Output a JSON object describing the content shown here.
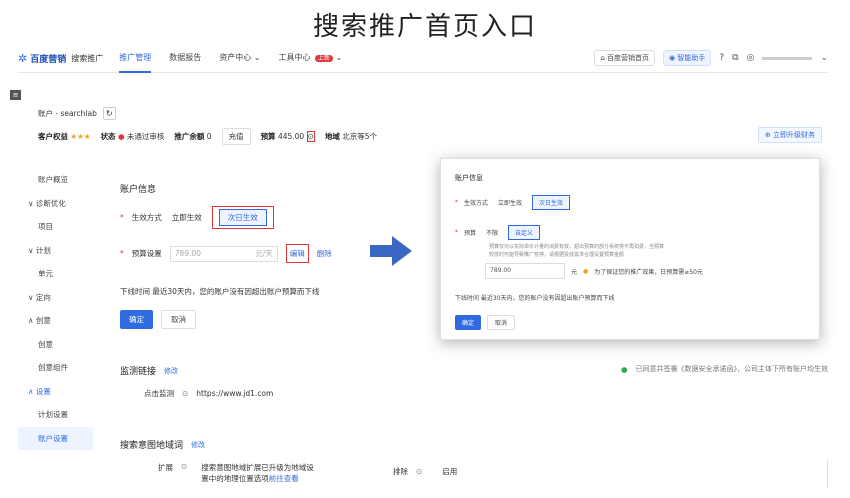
{
  "slide_title": "搜索推广首页入口",
  "topbar": {
    "logo": "百度营销",
    "logo_sub": "搜索推广",
    "nav": [
      {
        "label": "推广管理",
        "active": true
      },
      {
        "label": "数据报告",
        "active": false
      },
      {
        "label": "资产中心 ⌄",
        "active": false
      },
      {
        "label": "工具中心",
        "active": false
      }
    ],
    "tool_badge": "上新",
    "home_link": "百度营销首页",
    "assistant": "智能助手"
  },
  "account": {
    "name": "账户 - searchlab",
    "rights_label": "客户权益",
    "stars": "★★★",
    "status_label": "状态",
    "status_value": "未通过审核",
    "balance_label": "推广余额",
    "balance_value": "0",
    "recharge": "充值",
    "budget_label": "预算",
    "budget_value": "445.00",
    "region_label": "地域",
    "region_value": "北京等5个",
    "upgrade": "立即升级财务"
  },
  "sidebar": [
    {
      "label": "账户概览",
      "type": "item"
    },
    {
      "label": "诊断优化",
      "type": "group"
    },
    {
      "label": "项目",
      "type": "item"
    },
    {
      "label": "计划",
      "type": "group"
    },
    {
      "label": "单元",
      "type": "item"
    },
    {
      "label": "定向",
      "type": "group"
    },
    {
      "label": "创意",
      "type": "group-open"
    },
    {
      "label": "创意",
      "type": "item"
    },
    {
      "label": "创意组件",
      "type": "item"
    },
    {
      "label": "设置",
      "type": "group-open-blue"
    },
    {
      "label": "计划设置",
      "type": "item"
    },
    {
      "label": "账户设置",
      "type": "selected"
    }
  ],
  "account_info": {
    "title": "账户信息",
    "effect_label": "生效方式",
    "effect_immediate": "立即生效",
    "effect_nextday": "次日生效",
    "budget_label": "预算设置",
    "budget_placeholder": "789.00",
    "budget_unit": "元/天",
    "edit": "编辑",
    "delete": "删除",
    "offline_note": "下线时间  最近30天内，您的账户没有因超出账户预算而下线",
    "confirm": "确定",
    "cancel": "取消"
  },
  "monitor": {
    "title": "监测链接",
    "edit": "修改",
    "protocol_note": "已同意并签署《数据安全承诺函》，公司主体下所有账户均生效",
    "click_label": "点击监测",
    "click_value": "https://www.jd1.com"
  },
  "intent": {
    "title": "搜索意图地域词",
    "edit": "修改",
    "expand_label": "扩展",
    "expand_value_1": "搜索意图地域扩展已升级为地域设",
    "expand_value_2": "置中的地理位置选项",
    "goto": "前往查看",
    "exclude_label": "排除",
    "exclude_value": "启用"
  },
  "popup": {
    "title": "账户信息",
    "effect_label": "生效方式",
    "effect_immediate": "立即生效",
    "effect_nextday": "次日生效",
    "budget_label": "预算",
    "budget_unlimited": "不限",
    "budget_custom": "自定义",
    "hint_1": "预算仅对以实际单价计量的消费有效，超出预算的部分系统将不再扣费，当预算",
    "hint_2": "较低时可能导致推广暂停，请根据投放需求合理设置预算金额",
    "budget_value": "789.00",
    "unit": "元",
    "warn_text": "为了保证您的推广效果，日预算需≥50元",
    "offline_note": "下线时间  最近30天内，您的账户没有因超出账户预算而下线",
    "confirm": "确定",
    "cancel": "取消"
  }
}
